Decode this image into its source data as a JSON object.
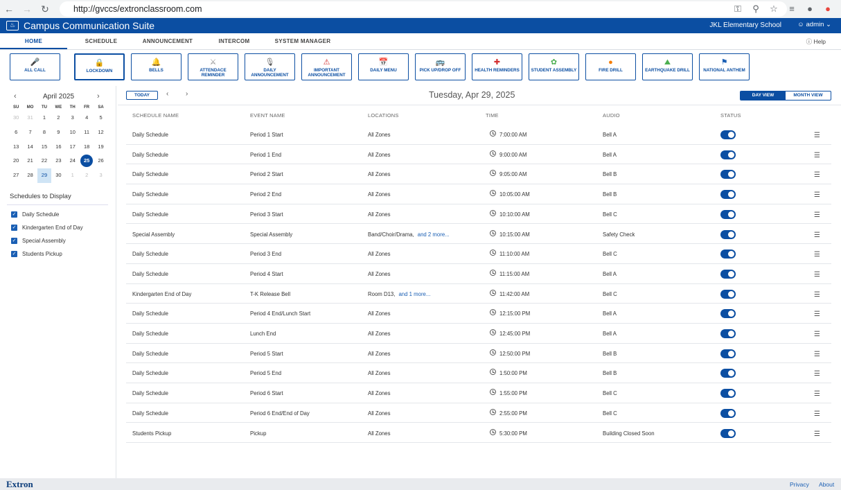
{
  "browser": {
    "url": "http://gvccs/extronclassroom.com",
    "icons": [
      "back-arrow-icon",
      "forward-arrow-icon",
      "reload-icon",
      "key-icon",
      "zoom-icon",
      "star-icon",
      "menu-list-icon",
      "profile-icon",
      "extension-icon"
    ]
  },
  "header": {
    "title": "Campus Communication Suite",
    "school": "JKL Elementary School",
    "user": "admin"
  },
  "tabs": [
    {
      "label": "HOME"
    },
    {
      "label": "SCHEDULE"
    },
    {
      "label": "ANNOUNCEMENT"
    },
    {
      "label": "INTERCOM"
    },
    {
      "label": "SYSTEM MANAGER"
    }
  ],
  "help_label": "Help",
  "quick_buttons": [
    {
      "label": "ALL CALL",
      "icon": "microphone-icon"
    },
    {
      "label": "LOCKDOWN",
      "icon": "lock-icon"
    },
    {
      "label": "BELLS",
      "icon": "bell-icon"
    },
    {
      "label": "ATTENDACE REMINDER",
      "icon": "attendance-icon"
    },
    {
      "label": "DAILY ANNOUNCEMENT",
      "icon": "mic-icon"
    },
    {
      "label": "IMPORTANT ANNOUNCEMENT",
      "icon": "alert-icon"
    },
    {
      "label": "DAILY MENU",
      "icon": "calendar-icon"
    },
    {
      "label": "PICK UP/DROP OFF",
      "icon": "bus-icon"
    },
    {
      "label": "HEALTH REMINDERS",
      "icon": "health-icon"
    },
    {
      "label": "STUDENT ASSEMBLY",
      "icon": "assembly-icon"
    },
    {
      "label": "FIRE DRILL",
      "icon": "fire-icon"
    },
    {
      "label": "EARTHQUAKE DRILL",
      "icon": "earthquake-icon"
    },
    {
      "label": "NATIONAL ANTHEM",
      "icon": "flag-icon"
    }
  ],
  "calendar": {
    "month": "April 2025",
    "dow": [
      "SU",
      "MO",
      "TU",
      "WE",
      "TH",
      "FR",
      "SA"
    ],
    "weeks": [
      [
        "30",
        "31",
        "1",
        "2",
        "3",
        "4",
        "5"
      ],
      [
        "6",
        "7",
        "8",
        "9",
        "10",
        "11",
        "12"
      ],
      [
        "13",
        "14",
        "15",
        "16",
        "17",
        "18",
        "19"
      ],
      [
        "20",
        "21",
        "22",
        "23",
        "24",
        "25",
        "26"
      ],
      [
        "27",
        "28",
        "29",
        "30",
        "1",
        "2",
        "3"
      ]
    ]
  },
  "schedules": {
    "title": "Schedules to Display",
    "items": [
      "Daily Schedule",
      "Kindergarten End of Day",
      "Special Assembly",
      "Students Pickup"
    ]
  },
  "toolbar": {
    "today": "TODAY",
    "date": "Tuesday, Apr 29, 2025",
    "day_view": "DAY VIEW",
    "month_view": "MONTH VIEW"
  },
  "table": {
    "headers": [
      "SCHEDULE NAME",
      "EVENT NAME",
      "LOCATIONS",
      "TIME",
      "AUDIO",
      "STATUS"
    ],
    "rows": [
      {
        "schedule": "Daily Schedule",
        "event": "Period 1 Start",
        "location": "All Zones",
        "more": "",
        "time": "7:00:00 AM",
        "audio": "Bell A"
      },
      {
        "schedule": "Daily Schedule",
        "event": "Period 1 End",
        "location": "All Zones",
        "more": "",
        "time": "9:00:00 AM",
        "audio": "Bell A"
      },
      {
        "schedule": "Daily Schedule",
        "event": "Period 2 Start",
        "location": "All Zones",
        "more": "",
        "time": "9:05:00 AM",
        "audio": "Bell B"
      },
      {
        "schedule": "Daily Schedule",
        "event": "Period 2 End",
        "location": "All Zones",
        "more": "",
        "time": "10:05:00 AM",
        "audio": "Bell B"
      },
      {
        "schedule": "Daily Schedule",
        "event": "Period 3 Start",
        "location": "All Zones",
        "more": "",
        "time": "10:10:00 AM",
        "audio": "Bell C"
      },
      {
        "schedule": "Special Assembly",
        "event": "Special Assembly",
        "location": "Band/Choir/Drama,",
        "more": "and 2 more...",
        "time": "10:15:00 AM",
        "audio": "Safety Check"
      },
      {
        "schedule": "Daily Schedule",
        "event": "Period 3 End",
        "location": "All Zones",
        "more": "",
        "time": "11:10:00 AM",
        "audio": "Bell C"
      },
      {
        "schedule": "Daily Schedule",
        "event": "Period 4 Start",
        "location": "All Zones",
        "more": "",
        "time": "11:15:00 AM",
        "audio": "Bell A"
      },
      {
        "schedule": "Kindergarten End of Day",
        "event": "T-K Release Bell",
        "location": "Room D13,",
        "more": "and 1 more...",
        "time": "11:42:00 AM",
        "audio": "Bell C"
      },
      {
        "schedule": "Daily Schedule",
        "event": "Period 4 End/Lunch Start",
        "location": "All Zones",
        "more": "",
        "time": "12:15:00 PM",
        "audio": "Bell A"
      },
      {
        "schedule": "Daily Schedule",
        "event": "Lunch End",
        "location": "All Zones",
        "more": "",
        "time": "12:45:00 PM",
        "audio": "Bell A"
      },
      {
        "schedule": "Daily Schedule",
        "event": "Period 5 Start",
        "location": "All Zones",
        "more": "",
        "time": "12:50:00 PM",
        "audio": "Bell B"
      },
      {
        "schedule": "Daily Schedule",
        "event": "Period 5 End",
        "location": "All Zones",
        "more": "",
        "time": "1:50:00 PM",
        "audio": "Bell B"
      },
      {
        "schedule": "Daily Schedule",
        "event": "Period 6 Start",
        "location": "All Zones",
        "more": "",
        "time": "1:55:00 PM",
        "audio": "Bell C"
      },
      {
        "schedule": "Daily Schedule",
        "event": "Period 6 End/End of Day",
        "location": "All Zones",
        "more": "",
        "time": "2:55:00 PM",
        "audio": "Bell C"
      },
      {
        "schedule": "Students Pickup",
        "event": "Pickup",
        "location": "All Zones",
        "more": "",
        "time": "5:30:00 PM",
        "audio": "Building Closed Soon"
      }
    ]
  },
  "footer": {
    "brand": "Extron",
    "privacy": "Privacy",
    "about": "About"
  },
  "colors": {
    "primary": "#0b4ea2",
    "link": "#1a5fb4"
  }
}
